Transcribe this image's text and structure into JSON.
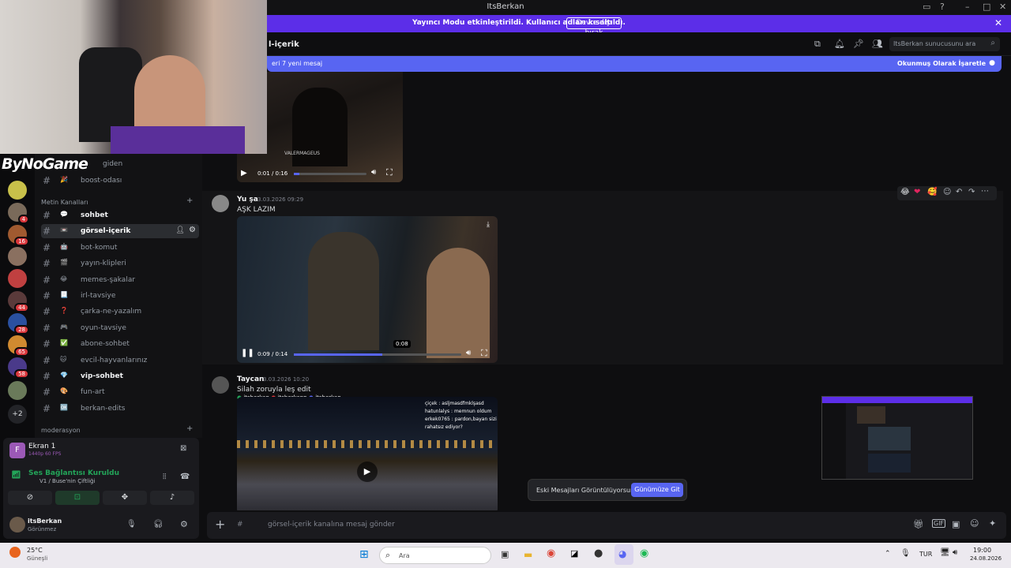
{
  "window": {
    "title": "ItsBerkan"
  },
  "banner": {
    "text": "Yayıncı Modu etkinleştirildi. Kullanıcı adları kısaltıldı.",
    "button": "Devre dışı bırak"
  },
  "overlay": {
    "logo": "ByNoGame"
  },
  "channels": {
    "partial_top": "giden",
    "items_top": [
      {
        "name": "boost-odası",
        "emoji": "🎉"
      }
    ],
    "category1": "Metin Kanalları",
    "items": [
      {
        "name": "sohbet",
        "emoji": "💬",
        "unread": true,
        "active": false
      },
      {
        "name": "görsel-içerik",
        "emoji": "📼",
        "unread": true,
        "active": true
      },
      {
        "name": "bot-komut",
        "emoji": "🤖",
        "unread": false,
        "active": false
      },
      {
        "name": "yayın-klipleri",
        "emoji": "🎬",
        "unread": false,
        "active": false
      },
      {
        "name": "memes-şakalar",
        "emoji": "😂",
        "unread": false,
        "active": false
      },
      {
        "name": "irl-tavsiye",
        "emoji": "📃",
        "unread": false,
        "active": false
      },
      {
        "name": "çarka-ne-yazalım",
        "emoji": "❓",
        "unread": false,
        "active": false
      },
      {
        "name": "oyun-tavsiye",
        "emoji": "🎮",
        "unread": false,
        "active": false
      },
      {
        "name": "abone-sohbet",
        "emoji": "✅",
        "unread": false,
        "active": false
      },
      {
        "name": "evcil-hayvanlarınız",
        "emoji": "🐱",
        "unread": false,
        "active": false
      },
      {
        "name": "vip-sohbet",
        "emoji": "💎",
        "unread": true,
        "active": false
      },
      {
        "name": "fun-art",
        "emoji": "🎨",
        "unread": false,
        "active": false
      },
      {
        "name": "berkan-edits",
        "emoji": "🆗",
        "unread": false,
        "active": false
      }
    ],
    "category2": "moderasyon"
  },
  "guild_badges": [
    "4",
    "16",
    "44",
    "28",
    "65",
    "58"
  ],
  "guild_more": "+2",
  "stream_panel": {
    "title": "Ekran 1",
    "sub": "1440p 60 FPS"
  },
  "voice": {
    "status": "Ses Bağlantısı Kuruldu",
    "channel": "V1 / Buse'nin Çiftliği"
  },
  "user": {
    "name": "itsBerkan",
    "status": "Görünmez"
  },
  "header": {
    "channel": "l-içerik",
    "search_placeholder": "ItsBerkan sunucusunu ara"
  },
  "newmsg": {
    "text": "eri 7 yeni mesaj",
    "action": "Okunmuş Olarak İşaretle"
  },
  "messages": [
    {
      "video_time": "0:01 / 0:16",
      "watermark": "VALERMAGEUS"
    },
    {
      "author": "Yu şa",
      "time": "3.03.2026 09:29",
      "text": "AŞK LAZIM",
      "video_time": "0:09 / 0:14",
      "tooltip": "0:08",
      "progress": 0.53
    },
    {
      "author": "Taycan",
      "time": "3.03.2026 10:20",
      "text": "Silah zoruyla leş edit",
      "tags": [
        "itsberkan",
        "itsberkann",
        "itsberkan"
      ],
      "overlay_lines": [
        "çiçek : asljmasdfmklşasd",
        "hatunlalys : memnun oldum",
        "erkek0765 : pardon,bayan sizi",
        "rahatsız ediyor?"
      ]
    }
  ],
  "old_messages": {
    "text": "Eski Mesajları Görüntülüyorsun",
    "button": "Günümüze Git"
  },
  "composer": {
    "placeholder": "görsel-içerik kanalına mesaj gönder"
  },
  "taskbar": {
    "weather_temp": "25°C",
    "weather_desc": "Güneşli",
    "search": "Ara",
    "lang": "TUR",
    "time": "19:00",
    "date": "24.08.2026"
  },
  "colors": {
    "accent": "#5865f2",
    "banner": "#5c2ee8",
    "green": "#23a559",
    "badge": "#da373c"
  }
}
